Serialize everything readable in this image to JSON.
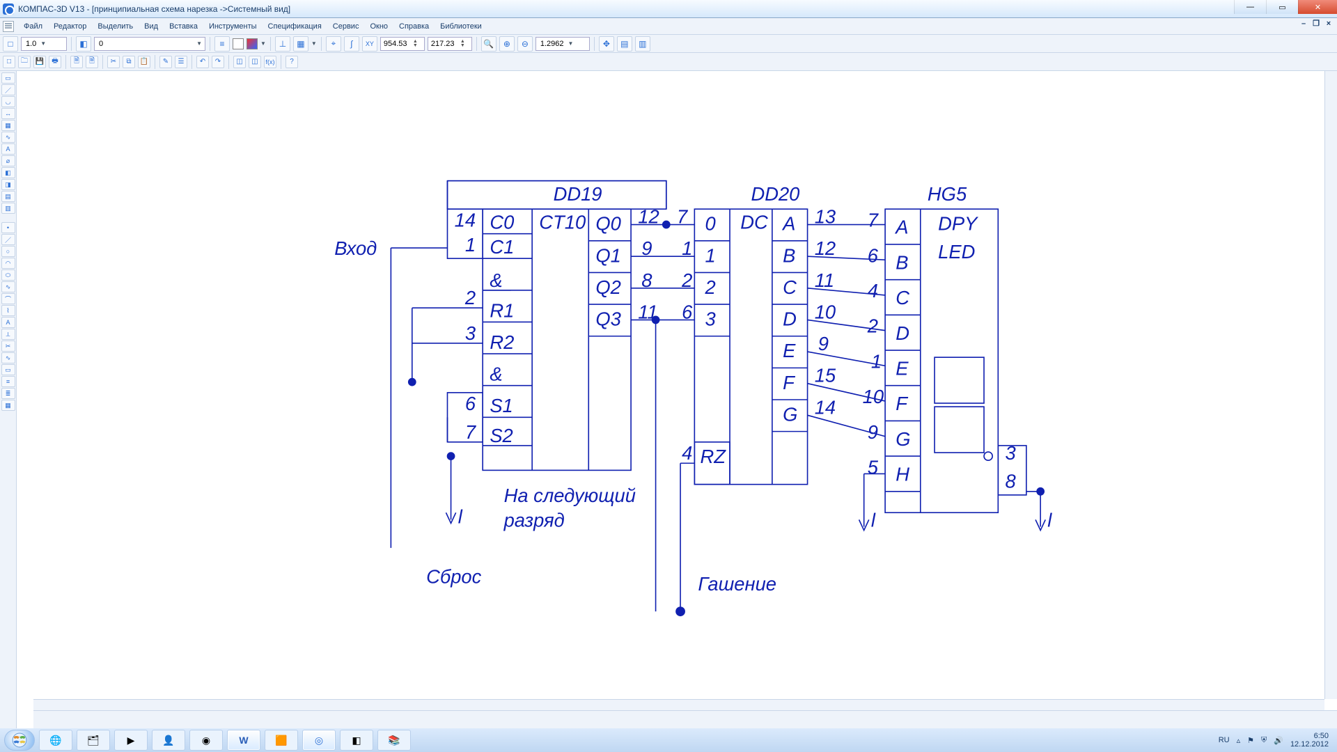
{
  "title": "КОМПАС-3D V13 - [принципиальная схема нарезка ->Системный вид]",
  "menu": [
    "Файл",
    "Редактор",
    "Выделить",
    "Вид",
    "Вставка",
    "Инструменты",
    "Спецификация",
    "Сервис",
    "Окно",
    "Справка",
    "Библиотеки"
  ],
  "toolbar1": {
    "scale_combo": "1.0",
    "layer_combo": "0",
    "coord_x": "954.53",
    "coord_y": "217.23",
    "zoom_combo": "1.2962"
  },
  "diagram": {
    "labels": {
      "dd19": "DD19",
      "dd20": "DD20",
      "hg5": "HG5",
      "ct10": "CT10",
      "dc": "DC",
      "dpy": "DPY",
      "led": "LED",
      "vhod": "Вход",
      "sbros": "Сброс",
      "gashenie": "Гашение",
      "nextdigit1": "На следующий",
      "nextdigit2": "разряд",
      "l1": "l",
      "l2": "l",
      "l3": "l",
      "rz": "RZ"
    },
    "dd19_left": [
      "C0",
      "C1",
      "&",
      "R1",
      "R2",
      "&",
      "S1",
      "S2"
    ],
    "dd19_left_pins": [
      "14",
      "1",
      "2",
      "3",
      "6",
      "7"
    ],
    "dd19_right": [
      "Q0",
      "Q1",
      "Q2",
      "Q3"
    ],
    "dd19_right_pins": [
      "12",
      "9",
      "8",
      "11"
    ],
    "dd20_left": [
      "0",
      "1",
      "2",
      "3"
    ],
    "dd20_left_pins": [
      "7",
      "1",
      "2",
      "6",
      "4"
    ],
    "dd20_right": [
      "A",
      "B",
      "C",
      "D",
      "E",
      "F",
      "G"
    ],
    "dd20_right_pins": [
      "13",
      "12",
      "11",
      "10",
      "9",
      "15",
      "14"
    ],
    "hg5_left": [
      "A",
      "B",
      "C",
      "D",
      "E",
      "F",
      "G",
      "H"
    ],
    "hg5_left_pins": [
      "7",
      "6",
      "4",
      "2",
      "1",
      "10",
      "9",
      "5"
    ],
    "hg5_right_pins": [
      "3",
      "8"
    ]
  },
  "tray": {
    "lang": "RU",
    "time": "6:50",
    "date": "12.12.2012"
  }
}
